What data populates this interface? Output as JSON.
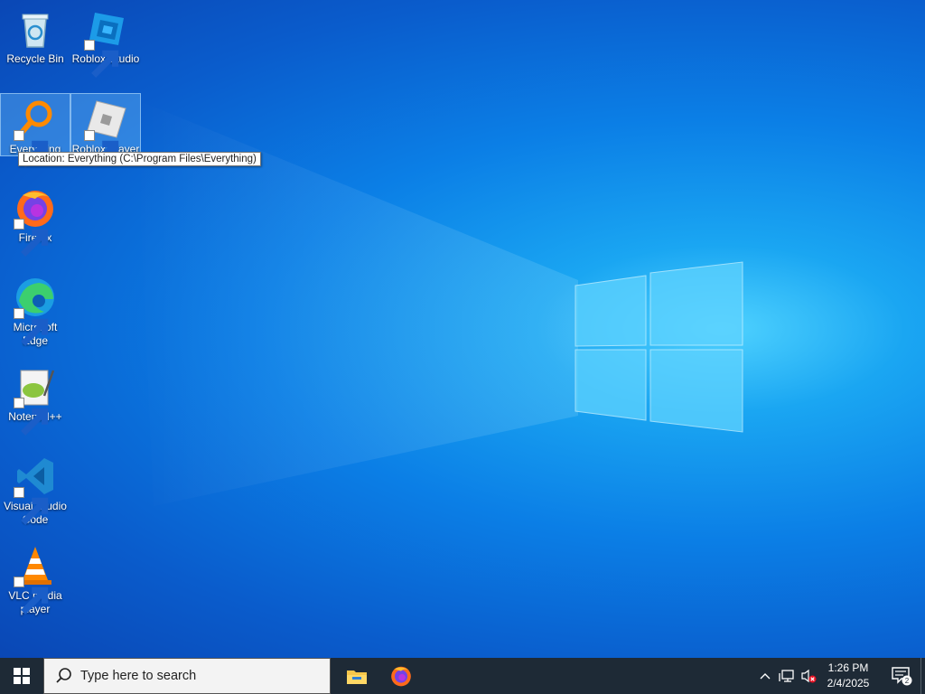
{
  "desktop": {
    "icons": [
      {
        "label": "Recycle Bin"
      },
      {
        "label": "Roblox Studio"
      },
      {
        "label": "Everything"
      },
      {
        "label": "Roblox Player"
      },
      {
        "label": "Firefox"
      },
      {
        "label": "Microsoft Edge"
      },
      {
        "label": "Notepad++"
      },
      {
        "label": "Visual Studio Code"
      },
      {
        "label": "VLC media player"
      }
    ],
    "tooltip": "Location: Everything (C:\\Program Files\\Everything)",
    "selected_icons": [
      "Everything",
      "Roblox Player"
    ]
  },
  "taskbar": {
    "search_placeholder": "Type here to search",
    "pinned_apps": [
      "file-explorer-icon",
      "firefox-icon"
    ],
    "time": "1:26 PM",
    "date": "2/4/2025",
    "notification_count": "2"
  },
  "colors": {
    "taskbar_bg": "#1e2a36",
    "desktop_accent": "#0b7fe6"
  }
}
